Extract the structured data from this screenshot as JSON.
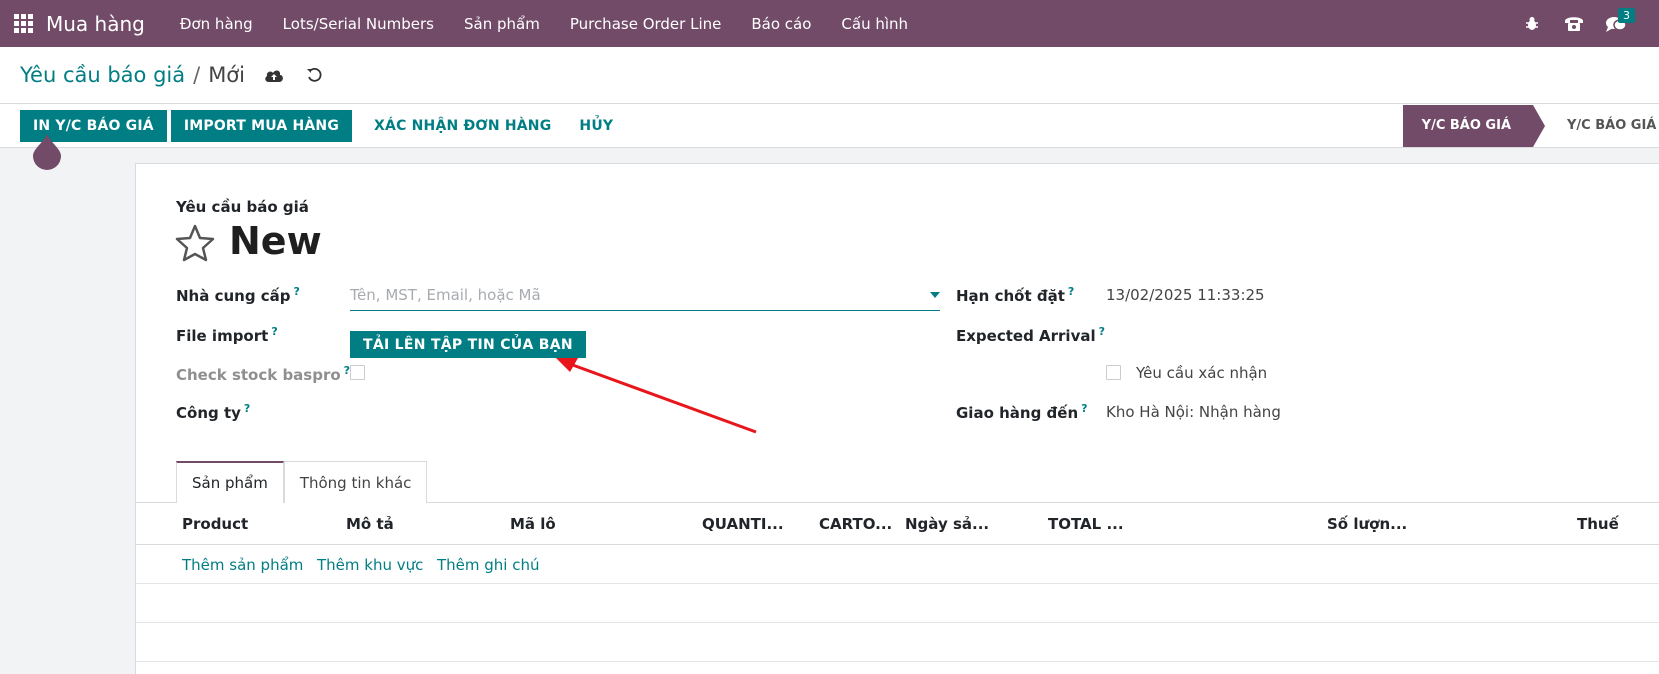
{
  "navbar": {
    "app_name": "Mua hàng",
    "menu": [
      "Đơn hàng",
      "Lots/Serial Numbers",
      "Sản phẩm",
      "Purchase Order Line",
      "Báo cáo",
      "Cấu hình"
    ],
    "message_count": "3",
    "icons": [
      "apps-grid-icon",
      "bug-icon",
      "phone-icon",
      "chat-icon"
    ]
  },
  "breadcrumb": {
    "parent": "Yêu cầu báo giá",
    "separator": "/",
    "current": "Mới"
  },
  "statusbar": {
    "buttons": [
      "IN Y/C BÁO GIÁ",
      "IMPORT MUA HÀNG",
      "XÁC NHẬN ĐƠN HÀNG",
      "HỦY"
    ],
    "stages": [
      "Y/C BÁO GIÁ",
      "Y/C BÁO GIÁ Đ"
    ],
    "active_stage": "Y/C BÁO GIÁ"
  },
  "form": {
    "doc_type": "Yêu cầu báo giá",
    "doc_name": "New",
    "vendor_label": "Nhà cung cấp",
    "vendor_placeholder": "Tên, MST, Email, hoặc Mã",
    "file_import_label": "File import",
    "upload_button": "TẢI LÊN TẬP TIN CỦA BẠN",
    "check_stock_label": "Check stock baspro",
    "company_label": "Công ty",
    "deadline_label": "Hạn chốt đặt",
    "deadline_value": "13/02/2025 11:33:25",
    "expected_arrival_label": "Expected Arrival",
    "ask_confirm_label": "Yêu cầu xác nhận",
    "deliver_to_label": "Giao hàng đến",
    "deliver_to_value": "Kho Hà Nội: Nhận hàng",
    "help_mark": "?"
  },
  "tabs": [
    "Sản phẩm",
    "Thông tin khác"
  ],
  "table": {
    "columns": [
      "Product",
      "Mô tả",
      "Mã lô",
      "QUANTI...",
      "CARTO...",
      "Ngày sả...",
      "TOTAL ...",
      "Số lượn...",
      "Thuế"
    ],
    "add_links": [
      "Thêm sản phẩm",
      "Thêm khu vực",
      "Thêm ghi chú"
    ]
  },
  "colors": {
    "brand": "#714b67",
    "primary": "#017e84",
    "annotation_arrow": "#e8161b"
  }
}
